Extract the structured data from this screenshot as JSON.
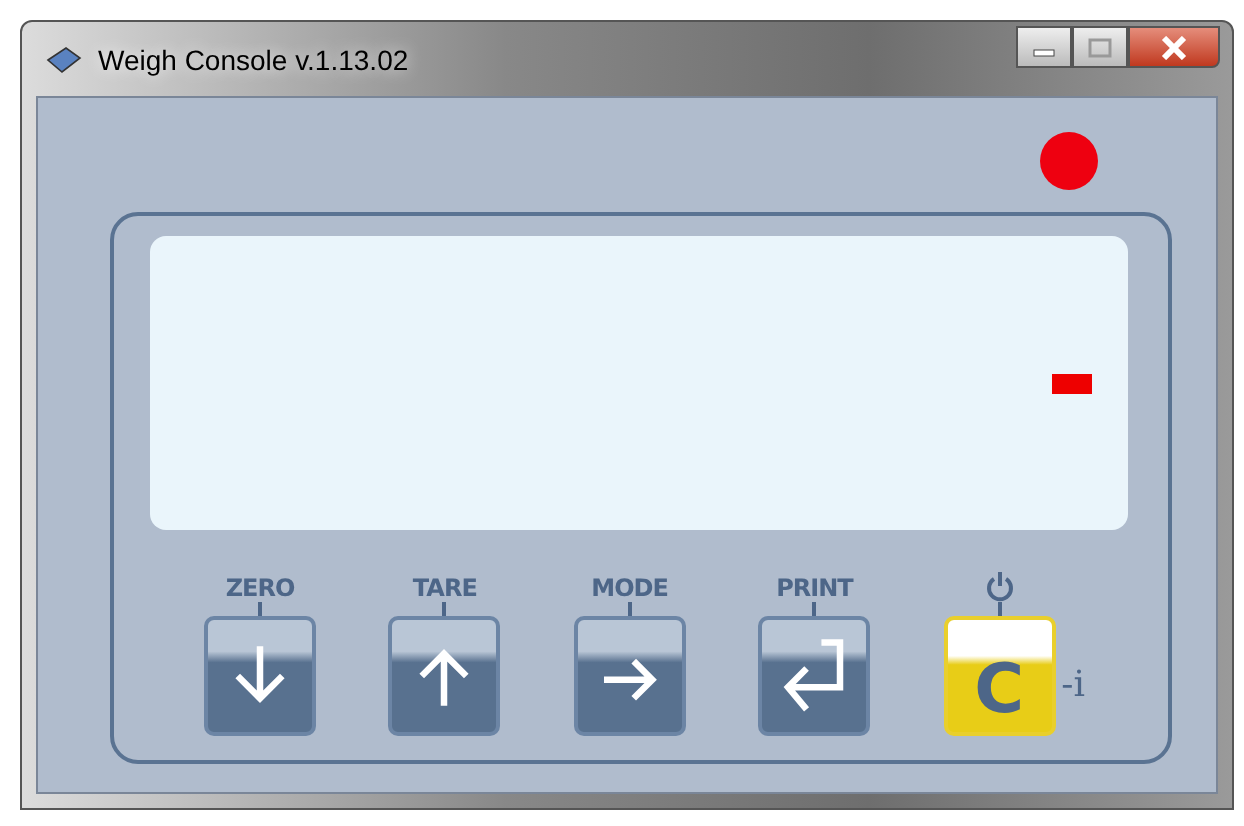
{
  "window": {
    "title": "Weigh Console v.1.13.02"
  },
  "indicator": {
    "on": true
  },
  "display": {
    "segment_on": true
  },
  "keys": [
    {
      "kind": "down",
      "label": "ZERO"
    },
    {
      "kind": "up",
      "label": "TARE"
    },
    {
      "kind": "right",
      "label": "MODE"
    },
    {
      "kind": "enter",
      "label": "PRINT"
    },
    {
      "kind": "clear",
      "letter": "C",
      "suffix": "-i"
    }
  ]
}
